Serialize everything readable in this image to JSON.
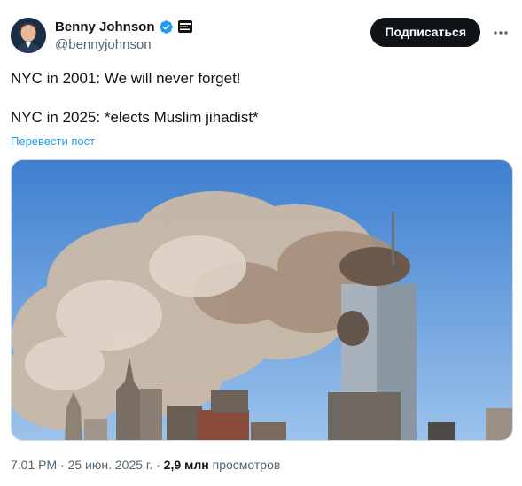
{
  "author": {
    "display_name": "Benny Johnson",
    "handle": "@bennyjohnson",
    "verified": true
  },
  "actions": {
    "subscribe_label": "Подписаться"
  },
  "tweet": {
    "line1": "NYC in 2001: We will never forget!",
    "line2": "NYC in 2025: *elects Muslim jihadist*",
    "translate_label": "Перевести пост"
  },
  "meta": {
    "time": "7:01 PM",
    "separator": "·",
    "date": "25 июн. 2025 г.",
    "views_count": "2,9 млн",
    "views_label": "просмотров"
  },
  "colors": {
    "accent": "#1d9bf0",
    "button_bg": "#0f1419",
    "secondary_text": "#536471"
  },
  "icons": {
    "verified": "verified-badge-icon",
    "affiliate": "affiliate-badge-icon",
    "more": "more-options-icon"
  }
}
